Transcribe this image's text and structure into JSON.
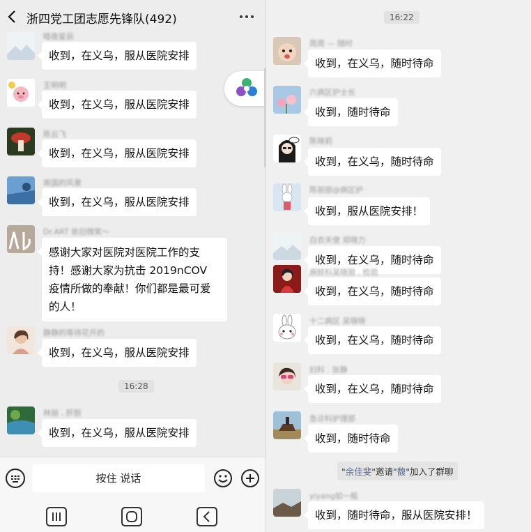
{
  "left": {
    "title": "浙四党工团志愿先锋队(492)",
    "messages": [
      {
        "sender": "暗夜星辰",
        "text": "收到，在义乌，服从医院安排"
      },
      {
        "sender": "王明明",
        "text": "收到，在义乌，服从医院安排"
      },
      {
        "sender": "陈云飞",
        "text": "收到，在义乌，服从医院安排"
      },
      {
        "sender": "南国的风景",
        "text": "收到，在义乌，服从医院安排"
      },
      {
        "sender": "Dr.ART  依旧微笑～",
        "text": "感谢大家对医院对医院工作的支持！感谢大家为抗击 2019nCOV 疫情所做的奉献！你们都是最可爱的人！"
      },
      {
        "sender": "静静的等待花开的",
        "text": "收到，在义乌，服从医院安排"
      },
      {
        "sender": "林丽 . 肝胆",
        "text": "收到，在义乌，服从医院安排"
      }
    ],
    "time": "16:28",
    "input": {
      "voice_label": "按住 说话"
    }
  },
  "right": {
    "time": "16:22",
    "messages": [
      {
        "sender": "周周 — 随时",
        "text": "收到，在义乌，随时待命"
      },
      {
        "sender": "六病区护士长",
        "text": "收到，随时待命"
      },
      {
        "sender": "陈晓莉",
        "text": "收到，在义乌，随时待命"
      },
      {
        "sender": "陈丽丽@病区护",
        "text": "收到，服从医院安排！"
      },
      {
        "sender": "白衣天使 郑晓力",
        "text": "收到，在义乌，随时待命"
      },
      {
        "sender": "麻醉科吴晓丽 . 检验",
        "text": "收到，在义乌，随时待命"
      },
      {
        "sender": "十二病区 吴晓晓",
        "text": "收到，在义乌，随时待命"
      },
      {
        "sender": "妇科 . 张静",
        "text": "收到，在义乌，随时待命"
      },
      {
        "sender": "急诊科护理部",
        "text": "收到，随时待命"
      },
      {
        "sender": "yiyang如一般",
        "text": "收到，随时待命，服从医院安排！"
      }
    ],
    "system": {
      "quote_open": "\"",
      "inviter": "余佳斐",
      "mid": "\"邀请\"",
      "invitee": "馥",
      "tail": "\"加入了群聊"
    }
  },
  "colors": {
    "bubble": "#ffffff",
    "background": "#ededed",
    "link": "#576b95"
  },
  "icons": [
    "back-icon",
    "more-icon",
    "keyboard-icon",
    "emoji-icon",
    "plus-icon",
    "menu-nav-icon",
    "home-nav-icon",
    "back-nav-icon",
    "assistant-float-icon"
  ]
}
